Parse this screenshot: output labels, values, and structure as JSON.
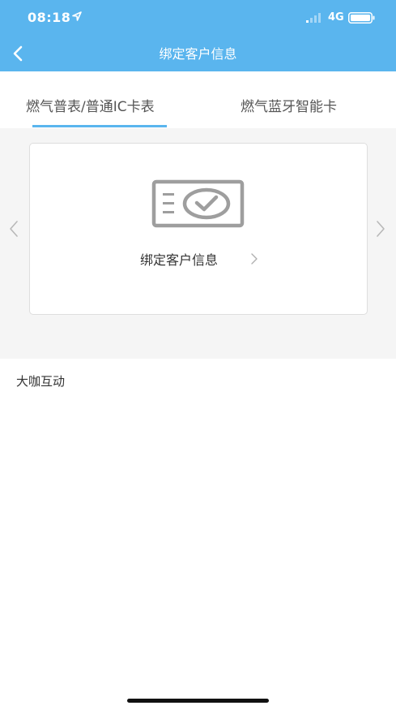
{
  "status_bar": {
    "time": "08:18",
    "network": "4G"
  },
  "nav": {
    "title": "绑定客户信息"
  },
  "tabs": [
    {
      "label": "燃气普表/普通IC卡表",
      "active": true
    },
    {
      "label": "燃气蓝牙智能卡",
      "active": false
    }
  ],
  "card": {
    "label": "绑定客户信息"
  },
  "footer": {
    "company": "大咖互动"
  },
  "colors": {
    "primary": "#5ab5ee",
    "background": "#f5f5f5",
    "text": "#333333",
    "muted": "#999999"
  }
}
